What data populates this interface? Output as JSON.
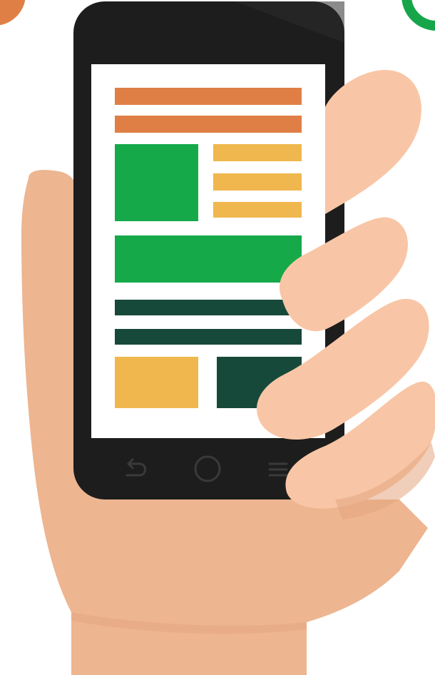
{
  "colors": {
    "skin": "#edb590",
    "skin_light": "#f8c6a6",
    "skin_shadow": "#e3a57f",
    "phone_body": "#1d1d1d",
    "phone_body_sheen": "#2c2c2c",
    "screen": "#ffffff",
    "orange": "#e07f45",
    "yellow": "#efb74d",
    "green": "#15a94a",
    "dark_green": "#17493a",
    "corner_orange": "#e07f45",
    "corner_green": "#17a54a",
    "nav_icon": "#3a3a3a"
  },
  "icons": {
    "back": "back-arrow-icon",
    "home": "home-circle-icon",
    "menu": "menu-lines-icon"
  }
}
